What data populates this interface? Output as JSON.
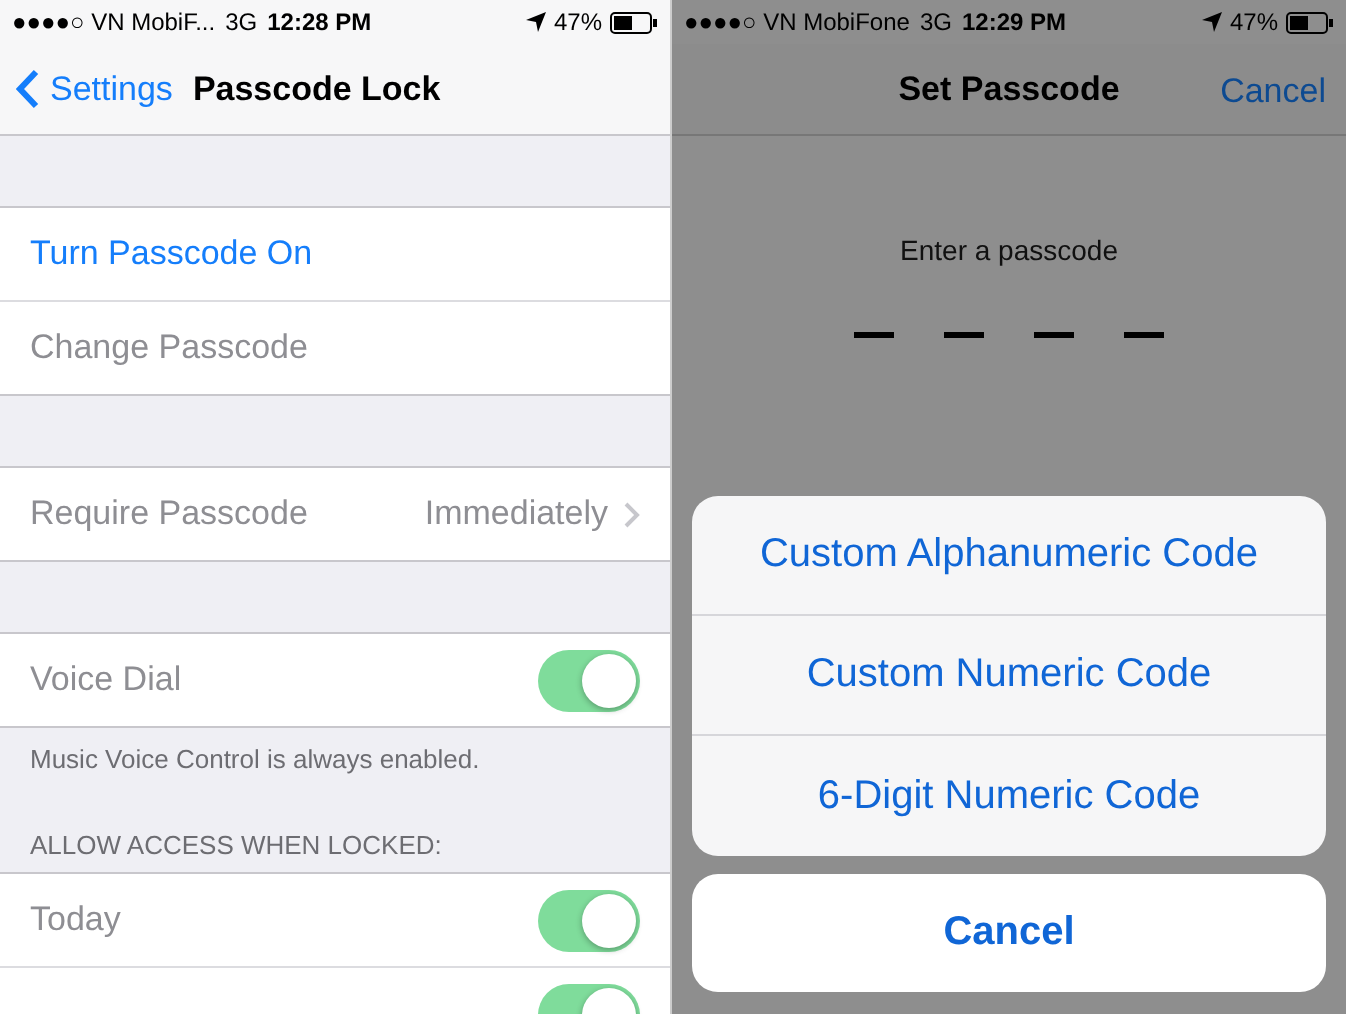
{
  "left": {
    "status_bar": {
      "carrier": "●●●●○ VN MobiF...",
      "network": "3G",
      "time": "12:28 PM",
      "battery": "47%"
    },
    "nav": {
      "back": "Settings",
      "title": "Passcode Lock"
    },
    "groups": [
      {
        "rows": [
          {
            "kind": "link",
            "label": "Turn Passcode On",
            "disabled": false
          },
          {
            "kind": "link",
            "label": "Change Passcode",
            "disabled": true
          }
        ]
      },
      {
        "rows": [
          {
            "kind": "detail",
            "label": "Require Passcode",
            "value": "Immediately",
            "disabled": true
          }
        ]
      },
      {
        "rows": [
          {
            "kind": "toggle",
            "label": "Voice Dial",
            "disabled": true,
            "on": true
          }
        ],
        "footer": "Music Voice Control is always enabled."
      },
      {
        "header": "ALLOW ACCESS WHEN LOCKED:",
        "rows": [
          {
            "kind": "toggle",
            "label": "Today",
            "disabled": true,
            "on": true
          },
          {
            "kind": "toggle",
            "disabled": true,
            "on": true
          }
        ]
      }
    ]
  },
  "right": {
    "status_bar": {
      "carrier": "●●●●○ VN MobiFone",
      "network": "3G",
      "time": "12:29 PM",
      "battery": "47%"
    },
    "nav": {
      "title": "Set Passcode",
      "action": "Cancel"
    },
    "prompt": "Enter a passcode",
    "digit_slots": [
      {
        "filled": false
      },
      {
        "filled": false
      },
      {
        "filled": false
      },
      {
        "filled": false
      }
    ],
    "action_sheet": {
      "options": [
        "Custom Alphanumeric Code",
        "Custom Numeric Code",
        "6-Digit Numeric Code"
      ],
      "cancel": "Cancel"
    }
  }
}
